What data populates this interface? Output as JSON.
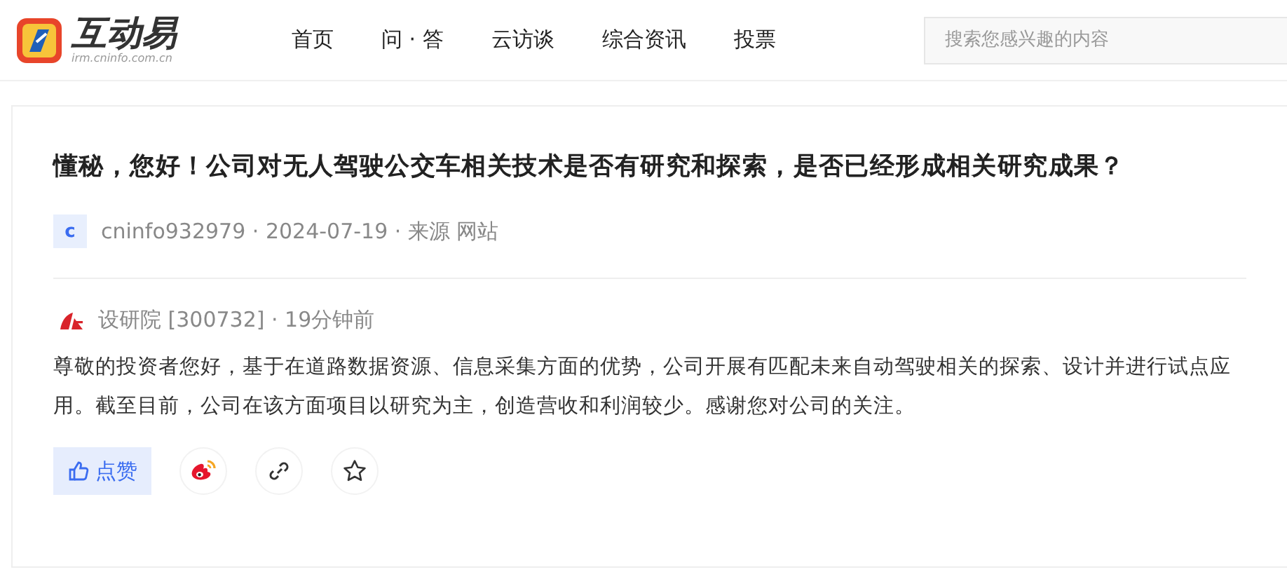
{
  "header": {
    "logo": {
      "title": "互动易",
      "subtitle": "irm.cninfo.com.cn"
    },
    "nav": [
      {
        "label": "首页",
        "selected": false
      },
      {
        "label": "问 · 答",
        "selected": false
      },
      {
        "label": "云访谈",
        "selected": false
      },
      {
        "label": "综合资讯",
        "selected": false
      },
      {
        "label": "投票",
        "selected": false
      }
    ],
    "search": {
      "placeholder": "搜索您感兴趣的内容"
    }
  },
  "question": {
    "title": "懂秘，您好！公司对无人驾驶公交车相关技术是否有研究和探索，是否已经形成相关研究成果？",
    "avatar": "c",
    "meta": "cninfo932979 · 2024-07-19 · 来源 网站"
  },
  "answer": {
    "company": "设研院 [300732] · 19分钟前",
    "text": "尊敬的投资者您好，基于在道路数据资源、信息采集方面的优势，公司开展有匹配未来自动驾驶相关的探索、设计并进行试点应用。截至目前，公司在该方面项目以研究为主，创造营收和利润较少。感谢您对公司的关注。"
  },
  "actions": [
    {
      "kind": "like",
      "label": "点赞"
    },
    {
      "kind": "weibo"
    },
    {
      "kind": "link"
    },
    {
      "kind": "star"
    }
  ]
}
